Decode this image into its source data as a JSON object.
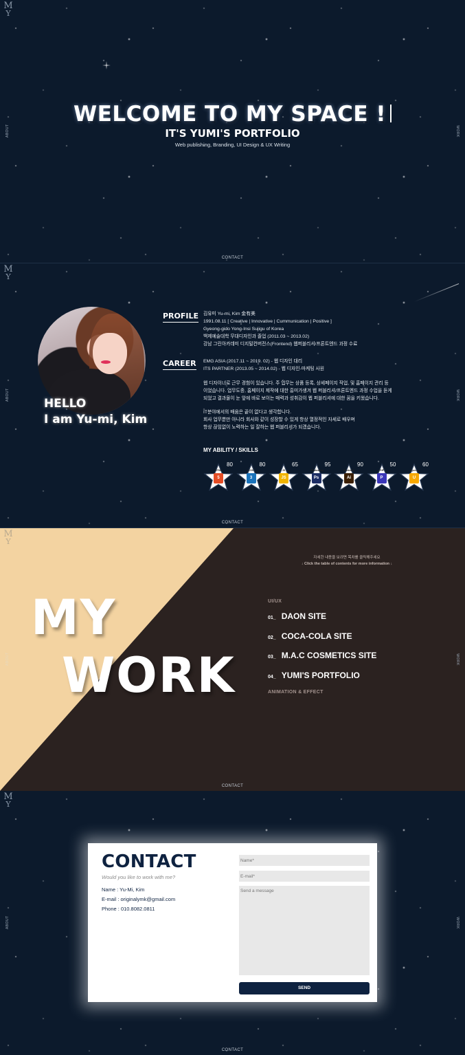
{
  "brand": {
    "logo_m": "M",
    "logo_y": "Y"
  },
  "nav": {
    "about": "ABOUT",
    "work": "WORK",
    "contact": "CONTACT"
  },
  "hero": {
    "title": "WELCOME TO MY SPACE !",
    "subtitle": "IT'S YUMI'S PORTFOLIO",
    "tagline": "Web publishing, Branding, UI Design & UX Writing"
  },
  "about": {
    "hello_line1": "HELLO",
    "hello_line2": "I am Yu-mi, Kim",
    "profile_label": "PROFILE",
    "profile": [
      "김유미 Yu-mi, Kim 金有美",
      "1991.08.11 [ Creative | Innovative | Cummunication | Positive ]",
      "Gyeong-gido Yong-Insi Sujigu of Korea",
      "백제예술대학 무대디자인과 졸업 (2011.03 ~ 2013.02)",
      "강남 그린아카데미 디지털컨버전스(Frontend) 웹퍼블리셔/프론트엔드 과정 수료"
    ],
    "career_label": "CAREER",
    "career": [
      "EMG ASIA (2017.11 ~ 2019. 02) - 웹 디자인 대리",
      "ITS PARTNER (2013.05 ~ 2014.02) - 웹 디자인-마케팅 사원"
    ],
    "intro1": [
      "웹 디자이너로 근무 경험이 있습니다. 주 업무는 상품 등록, 상세페이지 작업, 및 홈페이지 관리 등",
      "이었습니다. 업무도중, 홈페이지 제작에 대한 흥미가생겨 웹 퍼블리셔/프론트엔드 과정 수업을 듣게",
      "되었고 결과물이 눈 앞에 바로 보이는 매력과 성취감이 웹 퍼블리셔에 대한 꿈을 키웠습니다."
    ],
    "intro2": [
      "IT분야에서의 배움은 끝이 없다고 생각합니다.",
      "회사 업무뿐만 아니라 회사와 같이 성장할 수 있게 항상 열정적인 자세로 배우며",
      "항상 끊임없이 노력하는 일 잘하는 웹 퍼블리셔가 되겠습니다."
    ],
    "skills_title": "MY ABILITY / SKILLS",
    "skills": [
      {
        "name": "HTML",
        "percent": "80",
        "icon": "html5-icon",
        "color": "#e44d26",
        "glyph": "5"
      },
      {
        "name": "CSS",
        "percent": "80",
        "icon": "css3-icon",
        "color": "#1b73ba",
        "glyph": "3"
      },
      {
        "name": "JS",
        "percent": "65",
        "icon": "js-icon",
        "color": "#f0b400",
        "glyph": "JS"
      },
      {
        "name": "Photoshop",
        "percent": "95",
        "icon": "photoshop-icon",
        "color": "#1c2d64",
        "glyph": "Ps"
      },
      {
        "name": "Illustrator",
        "percent": "90",
        "icon": "illustrator-icon",
        "color": "#3a1f05",
        "glyph": "Ai"
      },
      {
        "name": "PHP",
        "percent": "50",
        "icon": "php-icon",
        "color": "#3b36b8",
        "glyph": "P"
      },
      {
        "name": "jQuery",
        "percent": "60",
        "icon": "jquery-icon",
        "color": "#f7a800",
        "glyph": "U"
      }
    ]
  },
  "work": {
    "title_line1": "MY",
    "title_line2": "WORK",
    "hint_ko": "자세한 내용을 보려면 목차를 클릭해주세요",
    "hint_en": "↓  Click the table of contents for more information  ↓",
    "category1": "UI/UX",
    "items": [
      {
        "num": "01_",
        "label": "DAON SITE"
      },
      {
        "num": "02_",
        "label": "COCA-COLA SITE"
      },
      {
        "num": "03_",
        "label": "M.A.C COSMETICS SITE"
      },
      {
        "num": "04_",
        "label": "YUMI'S PORTFOLIO"
      }
    ],
    "category2": "ANIMATION & EFFECT",
    "colors": {
      "beige": "#f3d3a1",
      "dark": "#2b2220"
    }
  },
  "contact": {
    "title": "CONTACT",
    "subtitle": "Would you like to work with me?",
    "name": "Name : Yu-Mi, Kim",
    "email": "E-mail : originalymk@gmail.com",
    "phone": "Phone : 010.8082.0811",
    "name_placeholder": "Name*",
    "email_placeholder": "E-mail*",
    "message_placeholder": "Send a message",
    "send_label": "SEND"
  }
}
